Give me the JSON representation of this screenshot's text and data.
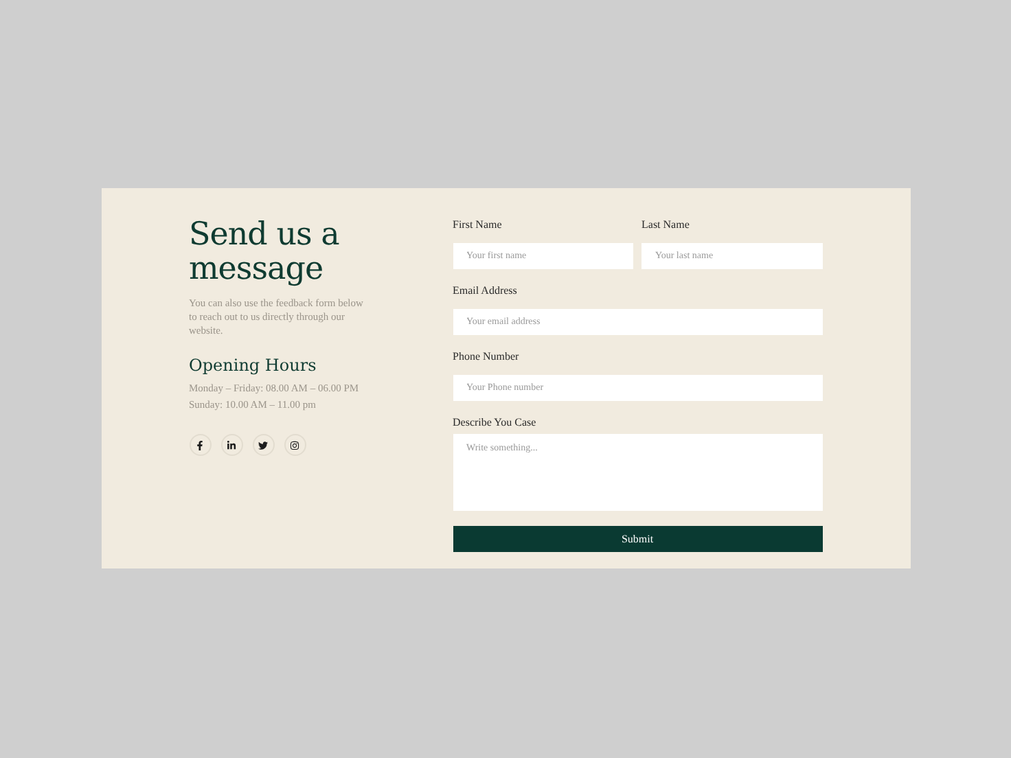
{
  "intro": {
    "title": "Send us a message",
    "text": "You can also use the feedback form below to reach out to us directly through our website."
  },
  "hours": {
    "title": "Opening Hours",
    "lines": [
      "Monday – Friday: 08.00 AM – 06.00 PM",
      "Sunday:  10.00 AM – 11.00 pm"
    ]
  },
  "social": [
    {
      "kind": "facebook"
    },
    {
      "kind": "linkedin"
    },
    {
      "kind": "twitter"
    },
    {
      "kind": "instagram"
    }
  ],
  "name_row": [
    {
      "label": "First Name",
      "placeholder": "Your first name"
    },
    {
      "label": "Last Name",
      "placeholder": "Your last name"
    }
  ],
  "fields": [
    {
      "label": "Email Address",
      "placeholder": "Your email address",
      "kind": "input"
    },
    {
      "label": "Phone Number",
      "placeholder": "Your Phone number",
      "kind": "input"
    },
    {
      "label": "Describe You Case",
      "placeholder": "Write something...",
      "kind": "textarea"
    }
  ],
  "submit": "Submit"
}
